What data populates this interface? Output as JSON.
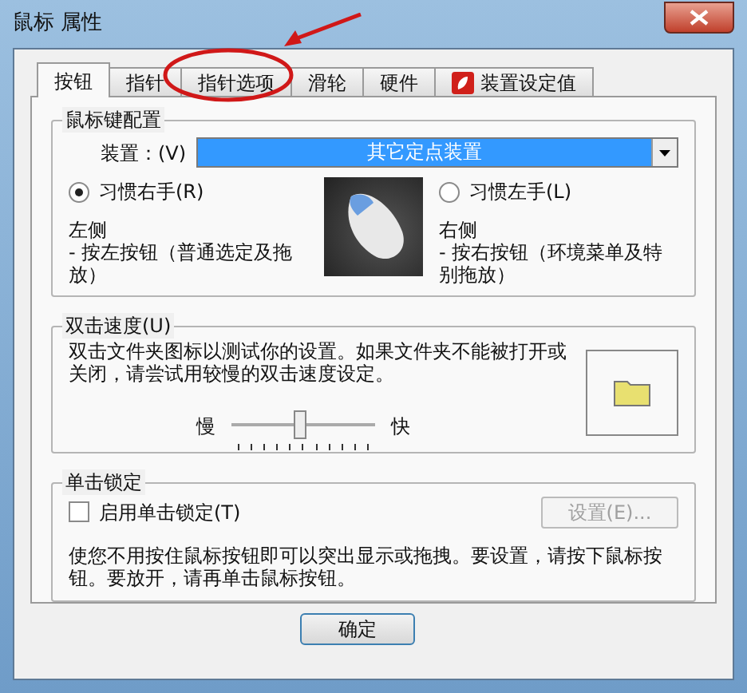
{
  "window": {
    "title": "鼠标 属性"
  },
  "tabs": [
    {
      "label": "按钮",
      "selected": true,
      "kind": "plain"
    },
    {
      "label": "指针",
      "selected": false,
      "kind": "plain"
    },
    {
      "label": "指针选项",
      "selected": false,
      "kind": "plain"
    },
    {
      "label": "滑轮",
      "selected": false,
      "kind": "plain"
    },
    {
      "label": "硬件",
      "selected": false,
      "kind": "plain"
    },
    {
      "label": "装置设定值",
      "selected": false,
      "kind": "icon"
    }
  ],
  "button_config": {
    "title": "鼠标键配置",
    "device_label": "装置：(V)",
    "device_value": "其它定点装置",
    "options": [
      {
        "label": "习惯右手(R)",
        "selected": true,
        "heading": "左侧",
        "text": "- 按左按钮（普通选定及拖放）"
      },
      {
        "label": "习惯左手(L)",
        "selected": false,
        "heading": "右侧",
        "text": "- 按右按钮（环境菜单及特别拖放）"
      }
    ]
  },
  "double_click": {
    "title": "双击速度(U)",
    "description": "双击文件夹图标以测试你的设置。如果文件夹不能被打开或关闭，请尝试用较慢的双击速度设定。",
    "slow_label": "慢",
    "fast_label": "快",
    "level": 0.48
  },
  "click_lock": {
    "title": "单击锁定",
    "checkbox": {
      "label": "启用单击锁定(T)",
      "checked": false
    },
    "settings_button": {
      "label": "设置(E)...",
      "disabled": true
    },
    "description": "使您不用按住鼠标按钮即可以突出显示或拖拽。要设置，请按下鼠标按钮。要放开，请再单击鼠标按钮。"
  },
  "buttons": [
    {
      "label": "确定"
    }
  ]
}
